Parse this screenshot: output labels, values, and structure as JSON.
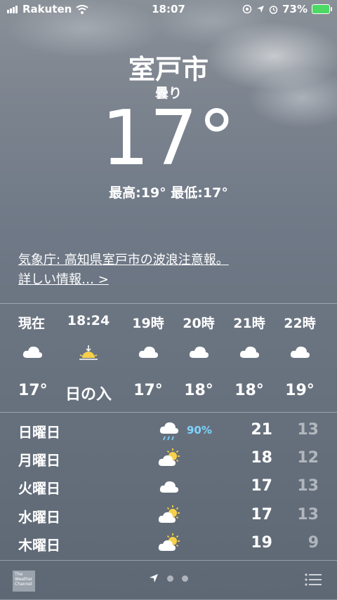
{
  "status_bar": {
    "carrier": "Rakuten",
    "time": "18:07",
    "battery": "73%"
  },
  "location": {
    "city": "室戸市",
    "condition": "曇り",
    "temperature": "17°",
    "hi_lo": "最高:19° 最低:17°"
  },
  "alert": {
    "line1": "気象庁: 高知県室戸市の波浪注意報。",
    "line2": "詳しい情報… >"
  },
  "hourly": [
    {
      "label": "現在",
      "icon": "cloud-icon",
      "value": "17°"
    },
    {
      "label": "18:24",
      "icon": "sunset-icon",
      "value": "日の入"
    },
    {
      "label": "19時",
      "icon": "cloud-icon",
      "value": "17°"
    },
    {
      "label": "20時",
      "icon": "cloud-icon",
      "value": "18°"
    },
    {
      "label": "21時",
      "icon": "cloud-icon",
      "value": "18°"
    },
    {
      "label": "22時",
      "icon": "cloud-icon",
      "value": "19°"
    }
  ],
  "daily": [
    {
      "day": "日曜日",
      "icon": "rain-cloud-icon",
      "precip": "90%",
      "hi": "21",
      "lo": "13"
    },
    {
      "day": "月曜日",
      "icon": "partly-cloudy-icon",
      "precip": "",
      "hi": "18",
      "lo": "12"
    },
    {
      "day": "火曜日",
      "icon": "cloud-icon",
      "precip": "",
      "hi": "17",
      "lo": "13"
    },
    {
      "day": "水曜日",
      "icon": "partly-cloudy-icon",
      "precip": "",
      "hi": "17",
      "lo": "13"
    },
    {
      "day": "木曜日",
      "icon": "partly-cloudy-icon",
      "precip": "",
      "hi": "19",
      "lo": "9"
    }
  ],
  "footer": {
    "logo_text": "The Weather Channel"
  }
}
